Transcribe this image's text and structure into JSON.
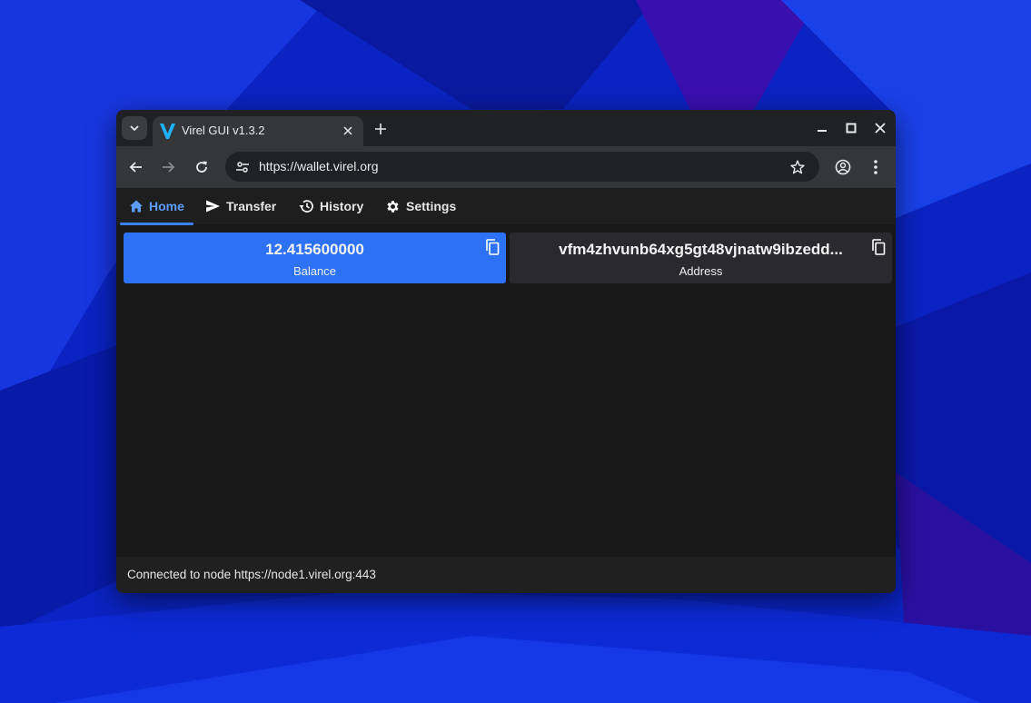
{
  "colors": {
    "accent": "#3b82f6",
    "balance_card": "#2d72f5",
    "address_card": "#2a2a2e",
    "content_bg": "#181818",
    "browser_frame": "#202124",
    "browser_toolbar": "#35363a"
  },
  "browser": {
    "tab": {
      "title": "Virel GUI v1.3.2",
      "favicon": "virel-v-logo-icon"
    },
    "url": "https://wallet.virel.org"
  },
  "app": {
    "nav": [
      {
        "label": "Home",
        "icon": "home-icon",
        "active": true
      },
      {
        "label": "Transfer",
        "icon": "send-icon",
        "active": false
      },
      {
        "label": "History",
        "icon": "history-icon",
        "active": false
      },
      {
        "label": "Settings",
        "icon": "gear-icon",
        "active": false
      }
    ],
    "balance": {
      "value": "12.415600000",
      "label": "Balance"
    },
    "address": {
      "value": "vfm4zhvunb64xg5gt48vjnatw9ibzedd...",
      "label": "Address"
    },
    "status": "Connected to node https://node1.virel.org:443"
  }
}
